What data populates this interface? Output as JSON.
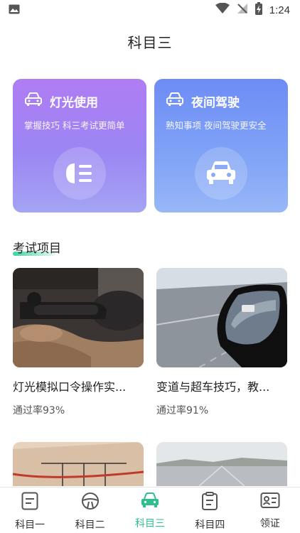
{
  "status_bar": {
    "time": "1:24",
    "icons": [
      "image-icon",
      "wifi-icon",
      "signal-off-icon",
      "battery-charging-icon"
    ]
  },
  "page": {
    "title": "科目三"
  },
  "cards": [
    {
      "title": "灯光使用",
      "subtitle": "掌握技巧 科三考试更简单",
      "icon": "headlight-icon"
    },
    {
      "title": "夜间驾驶",
      "subtitle": "熟知事项 夜间驾驶更安全",
      "icon": "car-icon"
    }
  ],
  "section": {
    "title": "考试项目"
  },
  "items": [
    {
      "title": "灯光模拟口令操作实...",
      "pass_rate": "通过率93%"
    },
    {
      "title": "变道与超车技巧，教...",
      "pass_rate": "通过率91%"
    }
  ],
  "bottom_nav": {
    "active": 2,
    "accent": "#2fbe8e",
    "items": [
      {
        "label": "科目一",
        "icon": "document-icon"
      },
      {
        "label": "科目二",
        "icon": "steering-wheel-icon"
      },
      {
        "label": "科目三",
        "icon": "car-icon"
      },
      {
        "label": "科目四",
        "icon": "clipboard-icon"
      },
      {
        "label": "领证",
        "icon": "id-card-icon"
      }
    ]
  }
}
